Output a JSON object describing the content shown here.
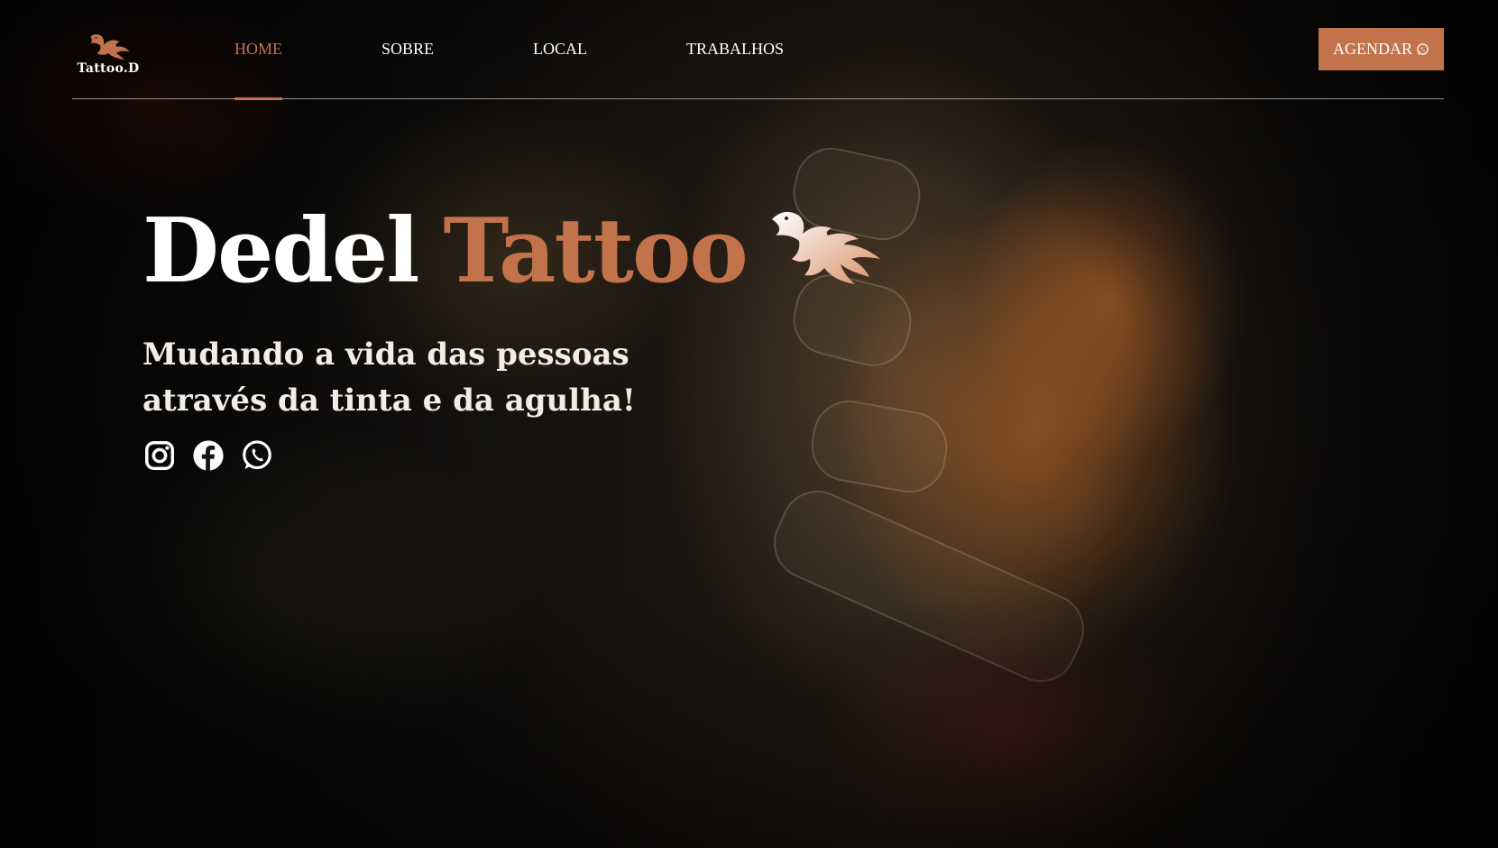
{
  "brand": {
    "logo_text": "Tattoo.D",
    "accent_color": "#c2734b"
  },
  "nav": {
    "items": [
      {
        "label": "HOME",
        "active": true
      },
      {
        "label": "SOBRE",
        "active": false
      },
      {
        "label": "LOCAL",
        "active": false
      },
      {
        "label": "TRABALHOS",
        "active": false
      }
    ],
    "cta_label": "AGENDAR",
    "cta_icon": "whatsapp-icon"
  },
  "hero": {
    "title_word_1": "Dedel",
    "title_word_2": "Tattoo",
    "subtitle": "Mudando a vida das pessoas através da tinta e da agulha!",
    "title_icon": "phoenix-icon",
    "social_icons": [
      "instagram-icon",
      "facebook-icon",
      "whatsapp-icon"
    ]
  }
}
